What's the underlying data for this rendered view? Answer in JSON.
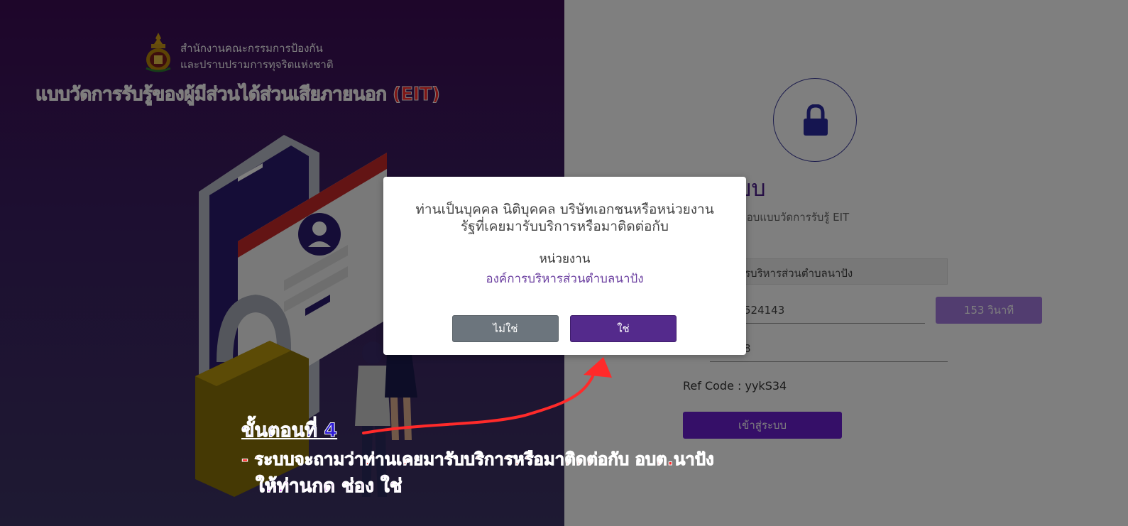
{
  "brand": {
    "org_line1": "สำนักงานคณะกรรมการป้องกัน",
    "org_line2": "และปราบปรามการทุจริตแห่งชาติ"
  },
  "banner": {
    "title": "แบบวัดการรับรู้ของผู้มีส่วนได้ส่วนเสียภายนอก (EIT)"
  },
  "login": {
    "heading_partial": "บบ",
    "subtitle_partial": "เพื่อตอบแบบวัดการรับรู้ EIT",
    "org_field_partial": "รบริหารส่วนตำบลนาปัง",
    "code_field_partial": "524143",
    "timer_label": "153 วินาที",
    "otp_field_partial": "8",
    "ref_code": "Ref Code : yykS34",
    "login_button": "เข้าสู่ระบบ"
  },
  "modal": {
    "question_line1": "ท่านเป็นบุคคล นิติบุคคล บริษัทเอกชนหรือหน่วยงาน",
    "question_line2": "รัฐที่เคยมารับบริการหรือมาติดต่อกับ",
    "agency_label": "หน่วยงาน",
    "agency_value": "องค์การบริหารส่วนตำบลนาปัง",
    "no_button": "ไม่ใช่",
    "yes_button": "ใช่"
  },
  "annotation": {
    "step_title": "ขั้นตอนที่ 4",
    "step_line1": "- ระบบจะถามว่าท่านเคยมารับบริการหรือมาติดต่อกับ อบต.นาปัง",
    "step_line2": "ให้ท่านกด ช่อง ใช่"
  },
  "colors": {
    "left_panel": "#3c0c55",
    "accent_purple": "#542a8c",
    "annotation_red": "#ff2a2a",
    "annotation_blue": "#2d1bd6",
    "annotation_magenta": "#c200f0"
  }
}
